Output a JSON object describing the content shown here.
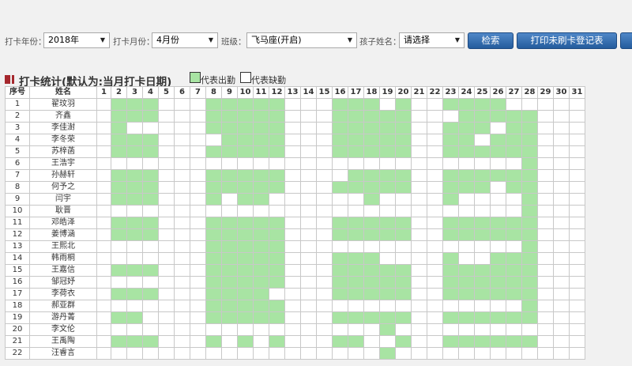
{
  "filters": {
    "year_label": "打卡年份：",
    "year_value": "2018年",
    "month_label": "打卡月份：",
    "month_value": "4月份",
    "class_label": "班级：",
    "class_value": "飞马座(开启)",
    "child_label": "孩子姓名：",
    "child_value": "请选择",
    "search_button": "检索",
    "print_button": "打印未刷卡登记表"
  },
  "section": {
    "title": "打卡统计(默认为:当月打卡日期)",
    "legend_present": "代表出勤",
    "legend_absent": "代表缺勤",
    "present_color": "#a8e4a3",
    "absent_color": "#ffffff"
  },
  "table": {
    "col_index": "序号",
    "col_name": "姓名",
    "days": [
      "1",
      "2",
      "3",
      "4",
      "5",
      "6",
      "7",
      "8",
      "9",
      "10",
      "11",
      "12",
      "13",
      "14",
      "15",
      "16",
      "17",
      "18",
      "19",
      "20",
      "21",
      "22",
      "23",
      "24",
      "25",
      "26",
      "27",
      "28",
      "29",
      "30",
      "31"
    ],
    "rows": [
      {
        "idx": "1",
        "name": "翟玟羽",
        "att": "0111000111110001110100111100000"
      },
      {
        "idx": "2",
        "name": "齐鑫",
        "att": "0111000111110001111100011111000"
      },
      {
        "idx": "3",
        "name": "李佳澍",
        "att": "0100000111110001111100111011000"
      },
      {
        "idx": "4",
        "name": "李冬荣",
        "att": "0111000011110001111100110111000"
      },
      {
        "idx": "5",
        "name": "苏梓菡",
        "att": "0111000111110001111100111111000"
      },
      {
        "idx": "6",
        "name": "王浩宇",
        "att": "0000000000000000000000000001000"
      },
      {
        "idx": "7",
        "name": "孙赫轩",
        "att": "0111000111110000111100111111000"
      },
      {
        "idx": "8",
        "name": "何予之",
        "att": "0111000111110001111100111011000"
      },
      {
        "idx": "9",
        "name": "闫宇",
        "att": "0111000101100000010000100001000"
      },
      {
        "idx": "10",
        "name": "耿晋",
        "att": "0000000000000000000000000001000"
      },
      {
        "idx": "11",
        "name": "邓皓泽",
        "att": "0111000111110001111100111111000"
      },
      {
        "idx": "12",
        "name": "姜博涵",
        "att": "0111000111110001111100111111000"
      },
      {
        "idx": "13",
        "name": "王熙北",
        "att": "0000000111110000000000000001000"
      },
      {
        "idx": "14",
        "name": "韩雨桐",
        "att": "0000000111110001110000100111000"
      },
      {
        "idx": "15",
        "name": "王嘉信",
        "att": "0111000111110001111100111111000"
      },
      {
        "idx": "16",
        "name": "邹冠妤",
        "att": "0000000111110001111100111111000"
      },
      {
        "idx": "17",
        "name": "李荷衣",
        "att": "0111000111100001111100111111000"
      },
      {
        "idx": "18",
        "name": "郝亚群",
        "att": "0000000111110000000000000001000"
      },
      {
        "idx": "19",
        "name": "游丹菁",
        "att": "0110000111110001111100111111000"
      },
      {
        "idx": "20",
        "name": "李文伦",
        "att": "0000000000000000001000000000000"
      },
      {
        "idx": "21",
        "name": "王禹陶",
        "att": "0111000101010001100100111111000"
      },
      {
        "idx": "22",
        "name": "汪睿言",
        "att": "0000000000000000001000000000000"
      }
    ]
  }
}
